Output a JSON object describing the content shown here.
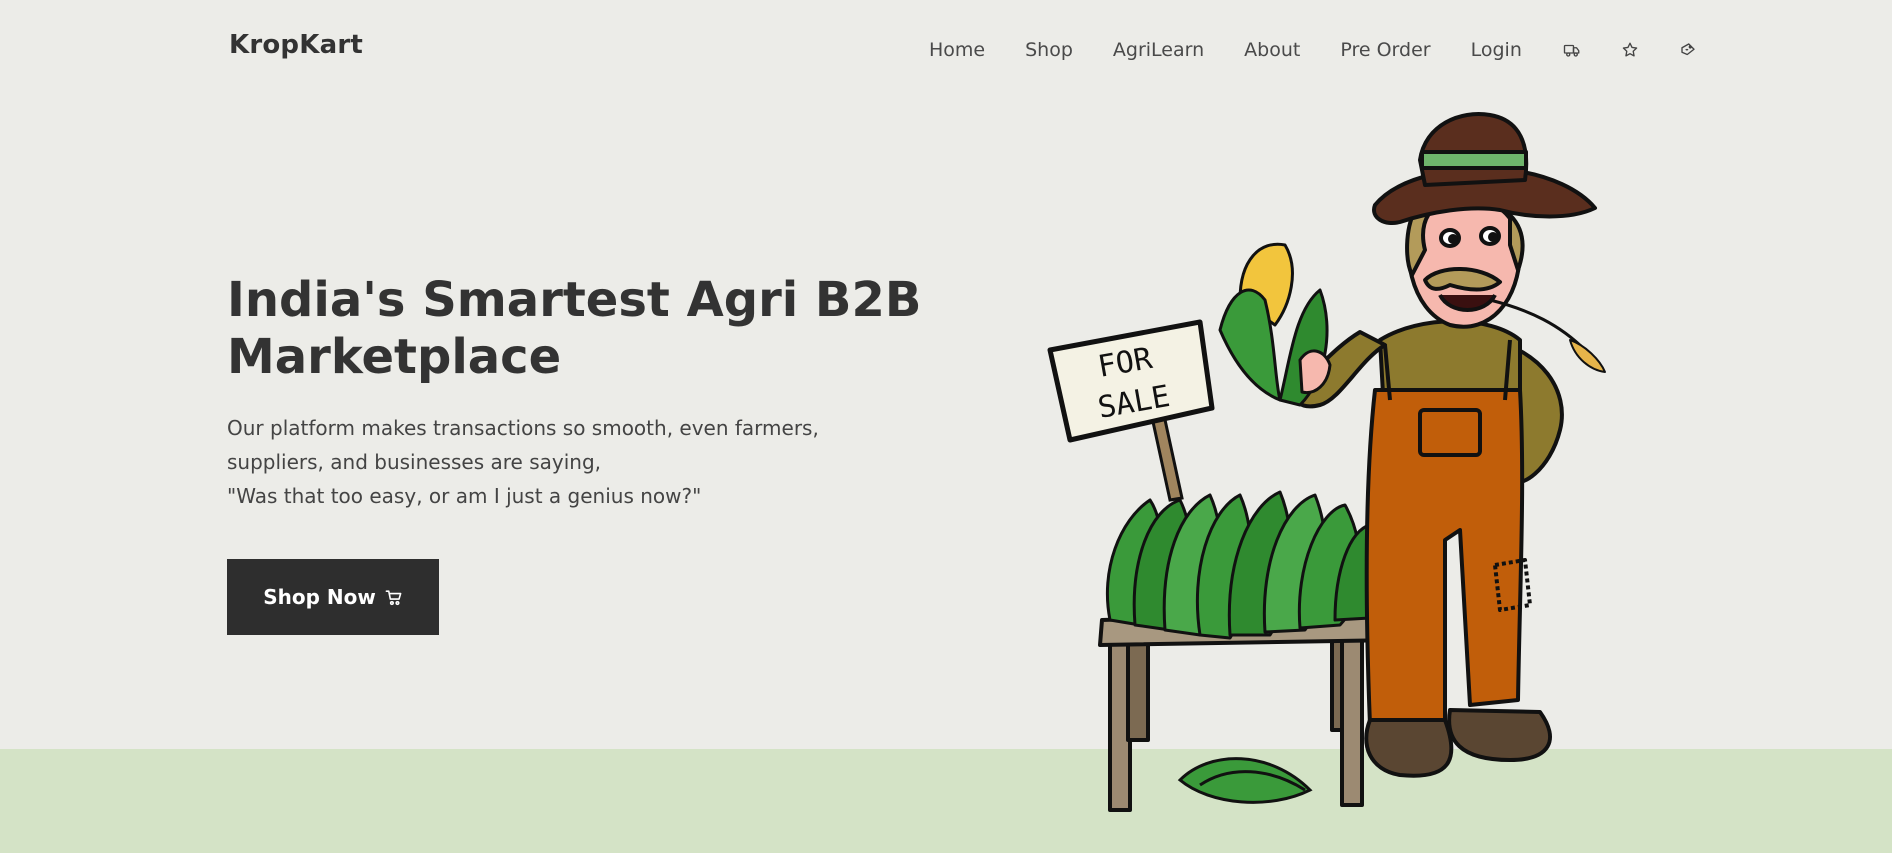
{
  "brand": {
    "name": "KropKart"
  },
  "nav": {
    "links": [
      "Home",
      "Shop",
      "AgriLearn",
      "About",
      "Pre Order",
      "Login"
    ],
    "icons": [
      "delivery-truck-icon",
      "star-icon",
      "shopping-bag-icon"
    ]
  },
  "hero": {
    "title": "India's Smartest Agri B2B Marketplace",
    "description_lines": [
      "Our platform makes transactions so smooth, even farmers,",
      "suppliers, and businesses are saying,",
      "\"Was that too easy, or am I just a genius now?\""
    ],
    "cta_label": "Shop Now",
    "cta_icon": "cart-icon"
  },
  "illustration": {
    "sign_text": [
      "FOR",
      "SALE"
    ],
    "subject": "farmer-with-corn-stand"
  },
  "colors": {
    "background": "#ecece8",
    "ground": "#d4e3c6",
    "text_dark": "#333333",
    "button_bg": "#2e2e2e",
    "button_text": "#ffffff"
  }
}
